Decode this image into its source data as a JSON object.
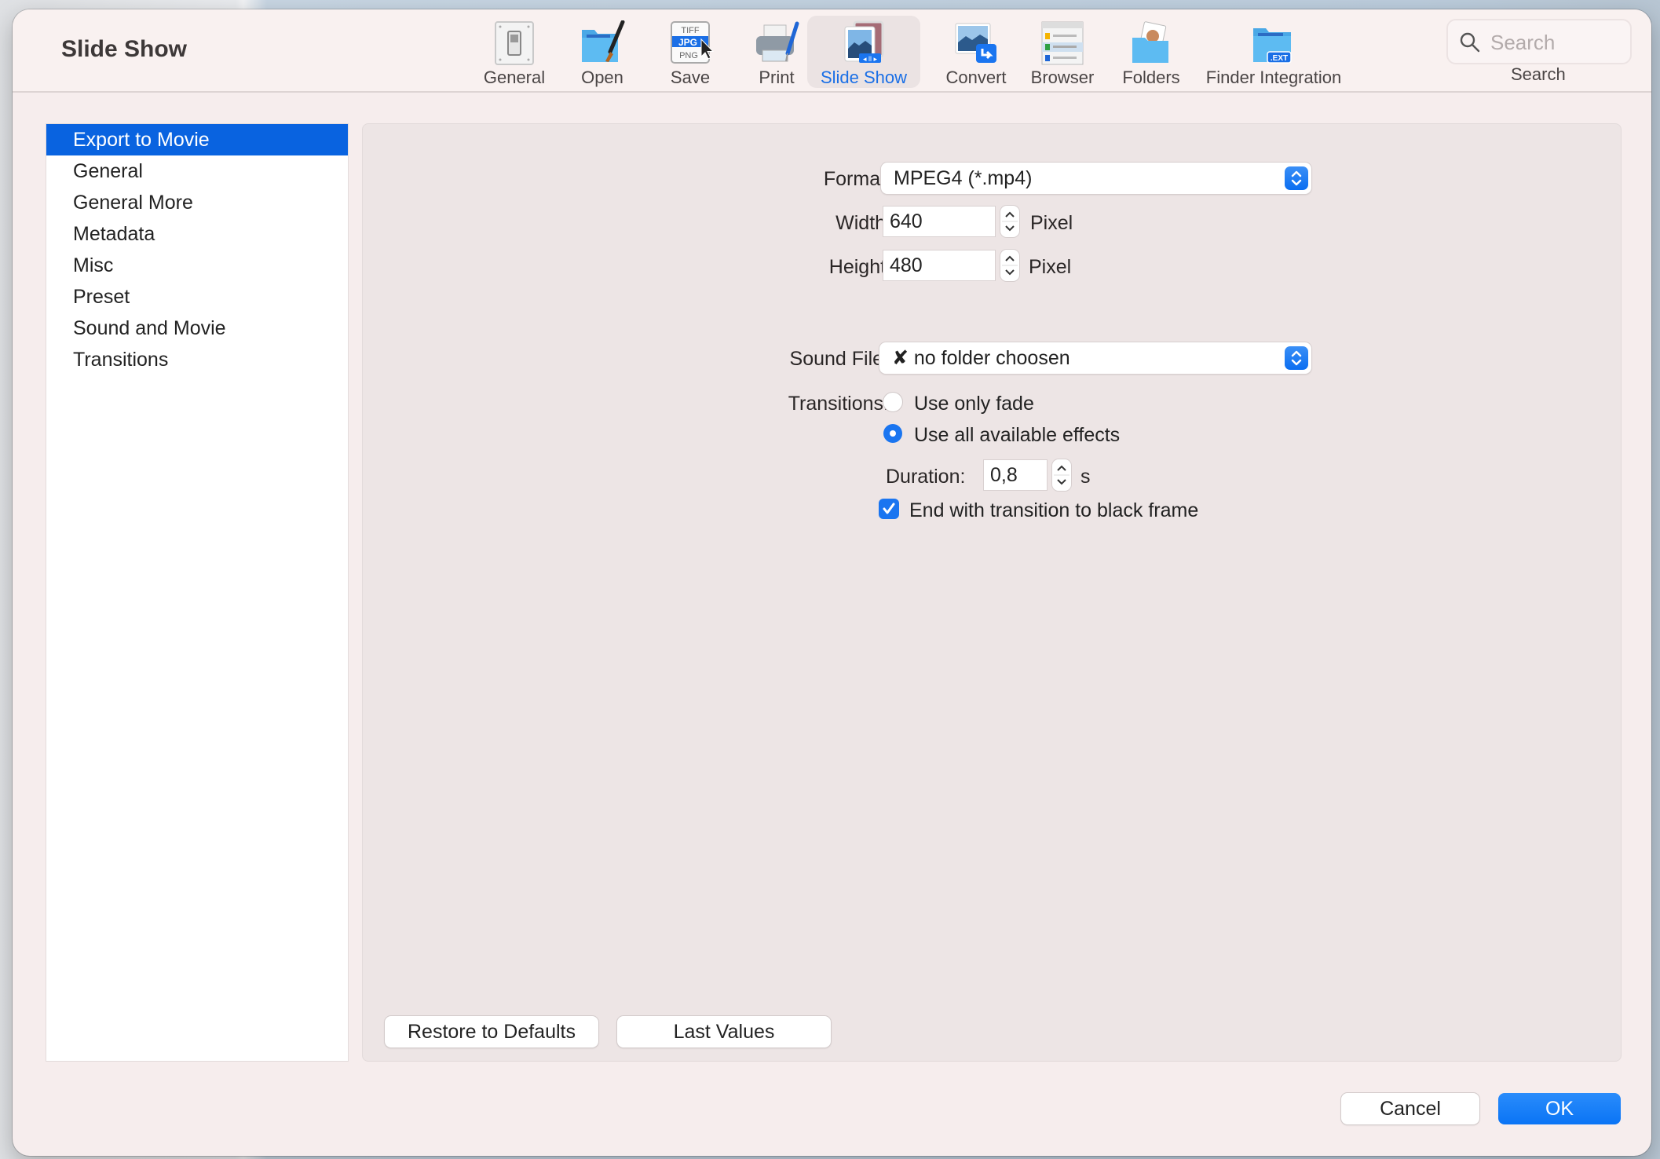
{
  "window": {
    "title": "Slide Show"
  },
  "toolbar": {
    "items": [
      {
        "label": "General",
        "icon": "switch-icon"
      },
      {
        "label": "Open",
        "icon": "folder-brush-icon"
      },
      {
        "label": "Save",
        "icon": "file-formats-icon"
      },
      {
        "label": "Print",
        "icon": "printer-icon"
      },
      {
        "label": "Slide Show",
        "icon": "slideshow-icon",
        "active": true
      },
      {
        "label": "Convert",
        "icon": "convert-icon"
      },
      {
        "label": "Browser",
        "icon": "browser-icon"
      },
      {
        "label": "Folders",
        "icon": "folders-icon"
      },
      {
        "label": "Finder Integration",
        "icon": "finder-ext-icon"
      }
    ],
    "search": {
      "placeholder": "Search",
      "value": "",
      "label": "Search"
    }
  },
  "sidebar": {
    "items": [
      {
        "label": "Export to Movie",
        "selected": true
      },
      {
        "label": "General"
      },
      {
        "label": "General More"
      },
      {
        "label": "Metadata"
      },
      {
        "label": "Misc"
      },
      {
        "label": "Preset"
      },
      {
        "label": "Sound and Movie"
      },
      {
        "label": "Transitions"
      }
    ]
  },
  "form": {
    "format": {
      "label": "Format:",
      "value": "MPEG4 (*.mp4)"
    },
    "width": {
      "label": "Width:",
      "value": "640",
      "unit": "Pixel"
    },
    "height": {
      "label": "Height:",
      "value": "480",
      "unit": "Pixel"
    },
    "sound_file": {
      "label": "Sound File:",
      "value": "✘ no folder choosen"
    },
    "transitions": {
      "label": "Transitions:",
      "options": [
        {
          "label": "Use only fade",
          "checked": false
        },
        {
          "label": "Use all available effects",
          "checked": true
        }
      ]
    },
    "duration": {
      "label": "Duration:",
      "value": "0,8",
      "unit": "s"
    },
    "end_black": {
      "label": "End with transition to black frame",
      "checked": true
    }
  },
  "panel_buttons": {
    "restore": "Restore to Defaults",
    "last_values": "Last Values"
  },
  "dialog_buttons": {
    "cancel": "Cancel",
    "ok": "OK"
  },
  "colors": {
    "accent": "#0a74f5",
    "selection": "#0963e0",
    "window_bg": "#f6eded"
  }
}
